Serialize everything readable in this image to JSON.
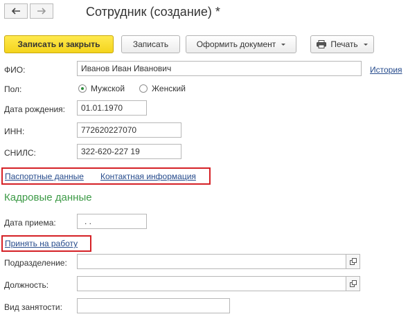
{
  "window": {
    "title": "Сотрудник (создание) *"
  },
  "nav": {
    "back_icon": "arrow-left-icon",
    "forward_icon": "arrow-right-icon"
  },
  "toolbar": {
    "save_close_label": "Записать и закрыть",
    "save_label": "Записать",
    "make_doc_label": "Оформить документ",
    "print_label": "Печать"
  },
  "form": {
    "fio": {
      "label": "ФИО:",
      "value": "Иванов Иван Иванович",
      "history_link": "История"
    },
    "gender": {
      "label": "Пол:",
      "options": [
        "Мужской",
        "Женский"
      ],
      "selected": "Мужской"
    },
    "birth_date": {
      "label": "Дата рождения:",
      "value": "01.01.1970"
    },
    "inn": {
      "label": "ИНН:",
      "value": "772620227070"
    },
    "snils": {
      "label": "СНИЛС:",
      "value": "322-620-227 19"
    },
    "links": {
      "passport": "Паспортные данные",
      "contacts": "Контактная информация"
    }
  },
  "hr": {
    "section_title": "Кадровые данные",
    "hire_date": {
      "label": "Дата приема:",
      "value": " .  ."
    },
    "hire_link": "Принять на работу",
    "department": {
      "label": "Подразделение:",
      "value": ""
    },
    "position": {
      "label": "Должность:",
      "value": ""
    },
    "employment": {
      "label": "Вид занятости:",
      "value": ""
    }
  },
  "colors": {
    "primary_button": "#f4d41c",
    "link": "#264b8c",
    "section": "#3c9a46",
    "highlight": "#d52025"
  }
}
